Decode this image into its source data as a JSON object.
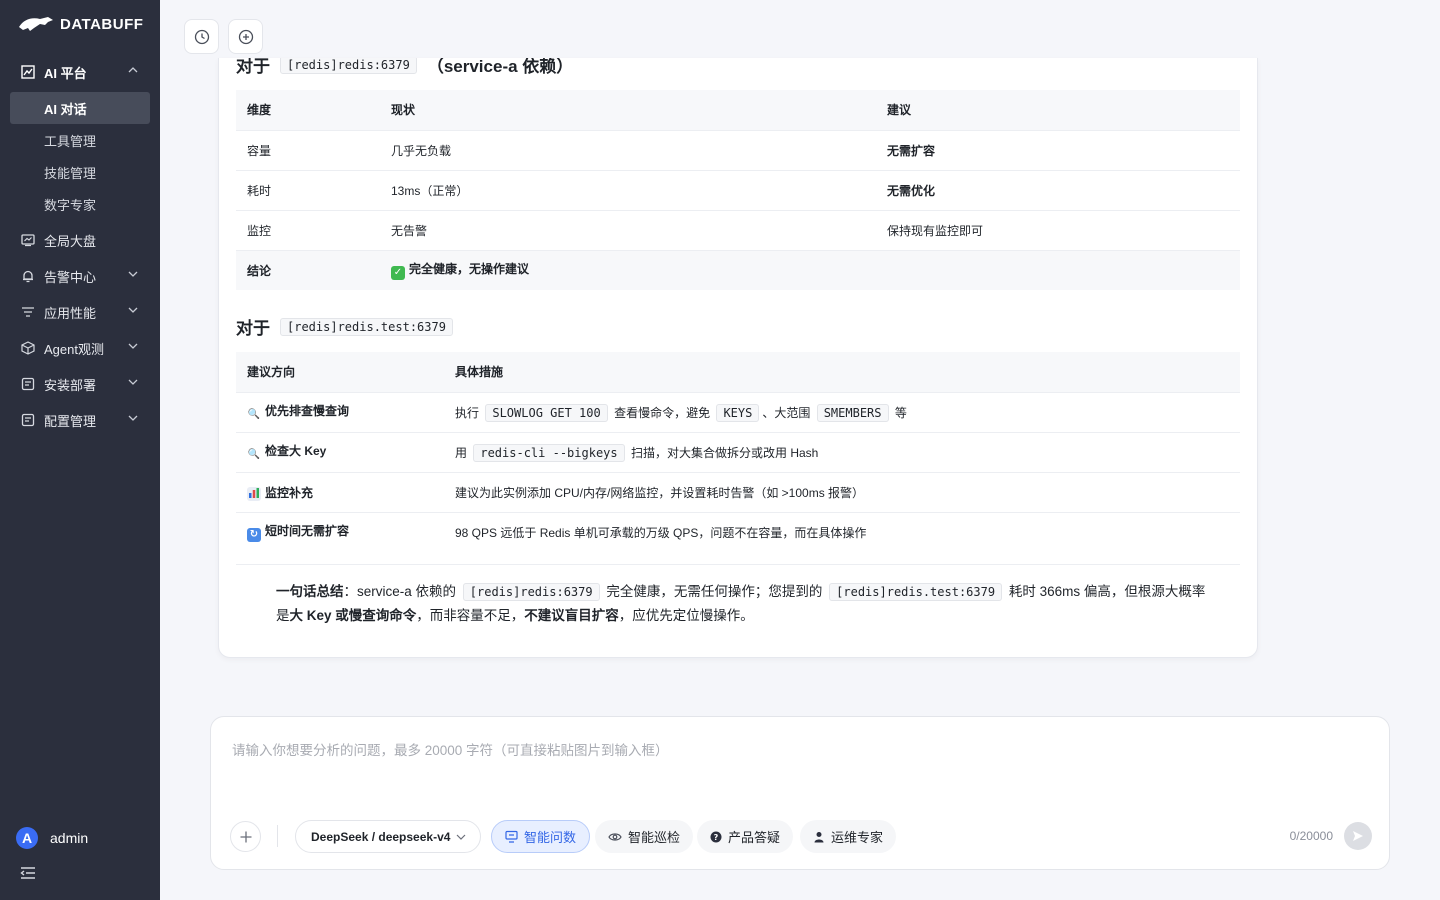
{
  "brand": {
    "name": "DATABUFF"
  },
  "sidebar": {
    "top_group": "AI 平台",
    "sub_items": [
      "AI 对话",
      "工具管理",
      "技能管理",
      "数字专家"
    ],
    "groups": [
      "全局大盘",
      "告警中心",
      "应用性能",
      "Agent观测",
      "安装部署",
      "配置管理"
    ]
  },
  "user": {
    "initial": "A",
    "name": "admin"
  },
  "section1": {
    "prefix": "对于",
    "code": "[redis]redis:6379",
    "suffix": "（service-a 依赖）",
    "headers": [
      "维度",
      "现状",
      "建议"
    ],
    "rows": [
      [
        "容量",
        "几乎无负载",
        "无需扩容"
      ],
      [
        "耗时",
        "13ms（正常）",
        "无需优化"
      ],
      [
        "监控",
        "无告警",
        "保持现有监控即可"
      ]
    ],
    "conclusion_label": "结论",
    "conclusion_text": "完全健康，无操作建议"
  },
  "section2": {
    "prefix": "对于",
    "code": "[redis]redis.test:6379",
    "headers": [
      "建议方向",
      "具体措施"
    ],
    "rows": [
      {
        "direction": "优先排查慢查询",
        "m1": "执行",
        "c1": "SLOWLOG GET 100",
        "m2": "查看慢命令，避免",
        "c2": "KEYS",
        "m3": "、大范围",
        "c3": "SMEMBERS",
        "m4": "等"
      },
      {
        "direction": "检查大 Key",
        "m1": "用",
        "c1": "redis-cli --bigkeys",
        "m2": "扫描，对大集合做拆分或改用 Hash"
      },
      {
        "direction": "监控补充",
        "m1": "建议为此实例添加 CPU/内存/网络监控，并设置耗时告警（如 >100ms 报警）"
      },
      {
        "direction": "短时间无需扩容",
        "m1": "98 QPS 远低于 Redis 单机可承载的万级 QPS，问题不在容量，而在具体操作"
      }
    ]
  },
  "summary": {
    "label": "一句话总结",
    "t1": "：service-a 依赖的",
    "c1": "[redis]redis:6379",
    "t2": "完全健康，无需任何操作；您提到的",
    "c2": "[redis]redis.test:6379",
    "t3": "耗时 366ms 偏高，但根源大概率是",
    "b1": "大 Key 或慢查询命令",
    "t4": "，而非容量不足，",
    "b2": "不建议盲目扩容",
    "t5": "，应优先定位慢操作。"
  },
  "input": {
    "placeholder": "请输入你想要分析的问题，最多 20000 字符（可直接粘贴图片到输入框）",
    "model": "DeepSeek / deepseek-v4",
    "modes": [
      "智能问数",
      "智能巡检",
      "产品答疑",
      "运维专家"
    ],
    "counter": "0/20000"
  }
}
